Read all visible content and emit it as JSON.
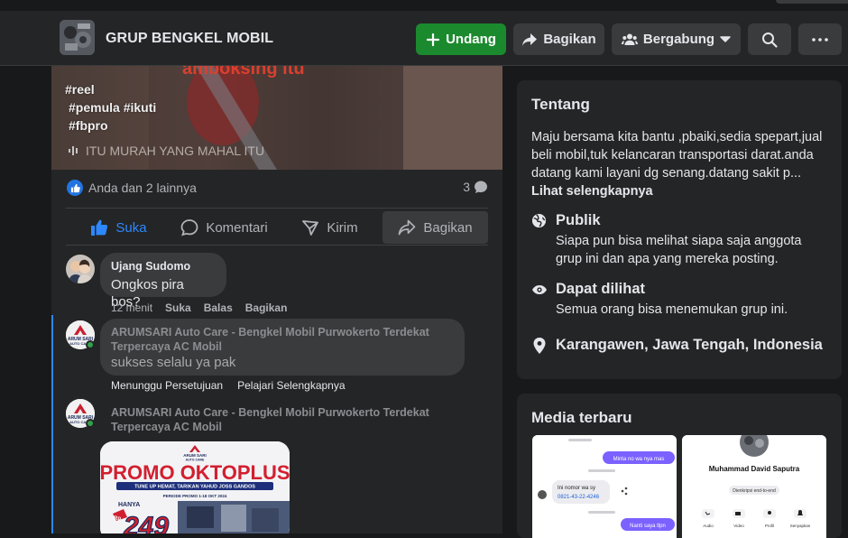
{
  "header": {
    "group_name": "GRUP BENGKEL MOBIL",
    "buttons": {
      "invite": "Undang",
      "share": "Bagikan",
      "join": "Bergabung"
    }
  },
  "post": {
    "reel_overlay_text": "amboksing itu",
    "reel_tags": [
      "#reel",
      "#pemula #ikuti",
      "#fbpro"
    ],
    "reel_caption": "ITU MURAH YANG MAHAL ITU",
    "reactions_text": "Anda dan 2 lainnya",
    "comment_count": "3",
    "actions": {
      "like": "Suka",
      "comment": "Komentari",
      "send": "Kirim",
      "share": "Bagikan"
    }
  },
  "comments": [
    {
      "author": "Ujang Sudomo",
      "text": "Ongkos pira bos?",
      "time": "12 menit",
      "like": "Suka",
      "reply": "Balas",
      "share": "Bagikan"
    },
    {
      "author_line1": "ARUMSARI Auto Care - Bengkel Mobil Purwokerto Terdekat",
      "author_line2": "Terpercaya AC Mobil",
      "text": "sukses selalu ya pak",
      "status": "Menunggu Persetujuan",
      "learn_more": "Pelajari Selengkapnya"
    },
    {
      "author_line1": "ARUMSARI Auto Care - Bengkel Mobil Purwokerto Terdekat",
      "author_line2": "Terpercaya AC Mobil",
      "promo_brand": "ARUM SARI",
      "promo_brand_sub": "AUTO CARE",
      "promo_title": "PROMO OKTOPLUS",
      "promo_subtitle": "TUNE UP HEMAT, TARIKAN YAHUD JOSS GANDOS",
      "promo_period": "PERIODE PROMO 1-18 OKT 2024",
      "promo_price_label": "HANYA",
      "promo_price": "249",
      "promo_currency": "Rp"
    }
  ],
  "avatar_brand": {
    "line1": "ARUM SARI",
    "line2": "AUTO CARE"
  },
  "about": {
    "title": "Tentang",
    "description": "Maju bersama kita bantu ,pbaiki,sedia spepart,jual beli mobil,tuk kelancaran transportasi darat.anda datang kami layani dg senang.datang sakit p...",
    "see_more": "Lihat selengkapnya",
    "privacy_title": "Publik",
    "privacy_desc": "Siapa pun bisa melihat siapa saja anggota grup ini dan apa yang mereka posting.",
    "visibility_title": "Dapat dilihat",
    "visibility_desc": "Semua orang bisa menemukan grup ini.",
    "location": "Karangawen, Jawa Tengah, Indonesia"
  },
  "media": {
    "title": "Media terbaru",
    "chat_bubble_1": "Minta no wa nya mas",
    "chat_bubble_2": "Ini nomor wa sy",
    "chat_phone": "0821-43-22-4246",
    "chat_bubble_3": "Nanti saya tlpn",
    "contact_name": "Muhammad David Saputra",
    "contact_sub": "Dienkripsi end-to-end",
    "contact_actions": [
      "Audio",
      "Video",
      "Profil",
      "Senyapkan"
    ]
  },
  "colors": {
    "invite_green": "#1b8a2e",
    "like_blue": "#2d88ff",
    "surface": "#242526",
    "background": "#18191a"
  }
}
